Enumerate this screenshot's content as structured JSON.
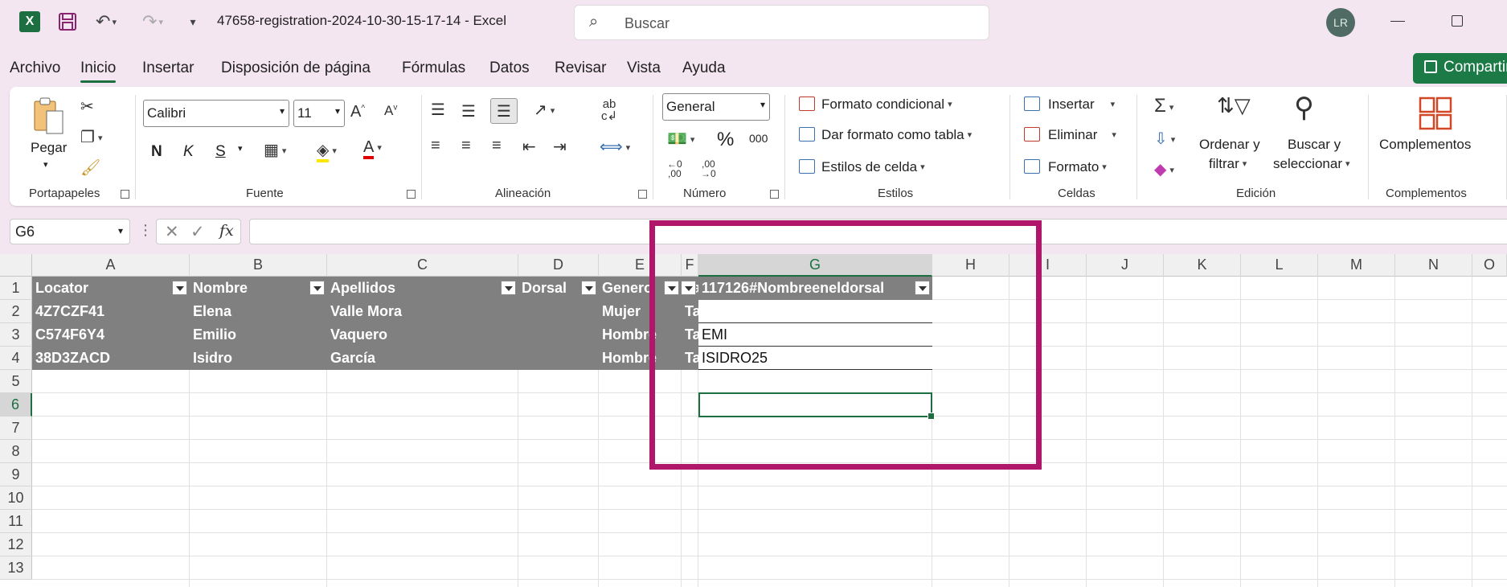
{
  "titlebar": {
    "doc_title": "47658-registration-2024-10-30-15-17-14  -  Excel",
    "search_placeholder": "Buscar",
    "avatar_initials": "LR"
  },
  "menu": {
    "tabs": [
      "Archivo",
      "Inicio",
      "Insertar",
      "Disposición de página",
      "Fórmulas",
      "Datos",
      "Revisar",
      "Vista",
      "Ayuda"
    ],
    "active_tab": "Inicio",
    "share_label": "Compartir"
  },
  "ribbon": {
    "clipboard": {
      "paste_label": "Pegar",
      "group_label": "Portapapeles"
    },
    "font": {
      "font_name": "Calibri",
      "font_size": "11",
      "bold": "N",
      "italic": "K",
      "underline": "S",
      "group_label": "Fuente"
    },
    "alignment": {
      "group_label": "Alineación"
    },
    "number": {
      "format": "General",
      "percent": "%",
      "thousands": "000",
      "group_label": "Número"
    },
    "styles": {
      "conditional": "Formato condicional",
      "as_table": "Dar formato como tabla",
      "cell_styles": "Estilos de celda",
      "group_label": "Estilos"
    },
    "cells": {
      "insert": "Insertar",
      "delete": "Eliminar",
      "format": "Formato",
      "group_label": "Celdas"
    },
    "editing": {
      "sort_line1": "Ordenar y",
      "sort_line2": "filtrar",
      "find_line1": "Buscar y",
      "find_line2": "seleccionar",
      "group_label": "Edición"
    },
    "addins": {
      "label": "Complementos",
      "group_label": "Complementos"
    }
  },
  "formula_bar": {
    "name_box": "G6",
    "formula": ""
  },
  "sheet": {
    "columns": [
      "A",
      "B",
      "C",
      "D",
      "E",
      "F",
      "G",
      "H",
      "I",
      "J",
      "K",
      "L",
      "M",
      "N",
      "O"
    ],
    "rows": [
      "1",
      "2",
      "3",
      "4",
      "5",
      "6",
      "7",
      "8",
      "9",
      "10",
      "11",
      "12",
      "13"
    ],
    "selected_column": "G",
    "selected_row": "6",
    "table_headers": [
      "Locator",
      "Nombre",
      "Apellidos",
      "Dorsal",
      "Genero",
      "Tarifa",
      "117126#Nombreeneldorsal"
    ],
    "table_rows": [
      [
        "4Z7CZF41",
        "Elena",
        "Valle Mora",
        "",
        "Mujer",
        "Tarifa básica",
        ""
      ],
      [
        "C574F6Y4",
        "Emilio",
        "Vaquero",
        "",
        "Hombre",
        "Tarifa básica",
        "EMI"
      ],
      [
        "38D3ZACD",
        "Isidro",
        "García",
        "",
        "Hombre",
        "Tarifa básica",
        "ISIDRO25"
      ]
    ]
  },
  "colors": {
    "accent": "#1d6f42",
    "highlight": "#b0176a",
    "table_fill": "#808080"
  }
}
